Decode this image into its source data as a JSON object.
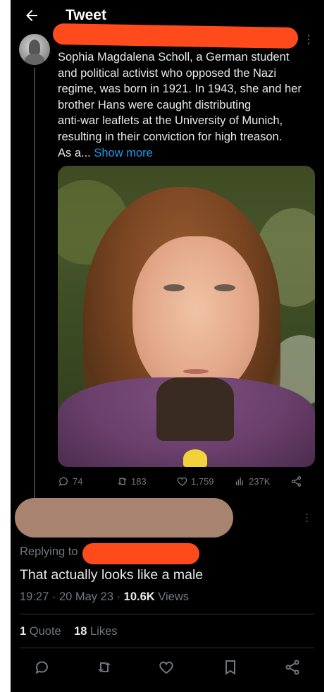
{
  "header": {
    "title": "Tweet",
    "back_icon": "arrow-left-icon"
  },
  "tweet": {
    "text": "Sophia Magdalena Scholl, a German student\nand political activist who opposed the Nazi\nregime, was born in 1921. In 1943, she and her\nbrother Hans were caught distributing\nanti-war leaflets at the University of Munich,\nresulting in their conviction for high treason.\nAs a... ",
    "show_more": "Show more",
    "actions": {
      "replies": "74",
      "retweets": "183",
      "likes": "1,759",
      "views": "237K"
    }
  },
  "reply": {
    "replying_to": "Replying to",
    "text": "That actually looks like a male",
    "time": "19:27 · 20 May 23 · ",
    "views_count": "10.6K",
    "views_label": " Views",
    "quote_count": "1",
    "quote_label": " Quote",
    "likes_count": "18",
    "likes_label": " Likes"
  },
  "colors": {
    "background": "#000000",
    "link": "#1d9bf0",
    "muted": "#71767b",
    "redaction": "#ff4a1c"
  }
}
